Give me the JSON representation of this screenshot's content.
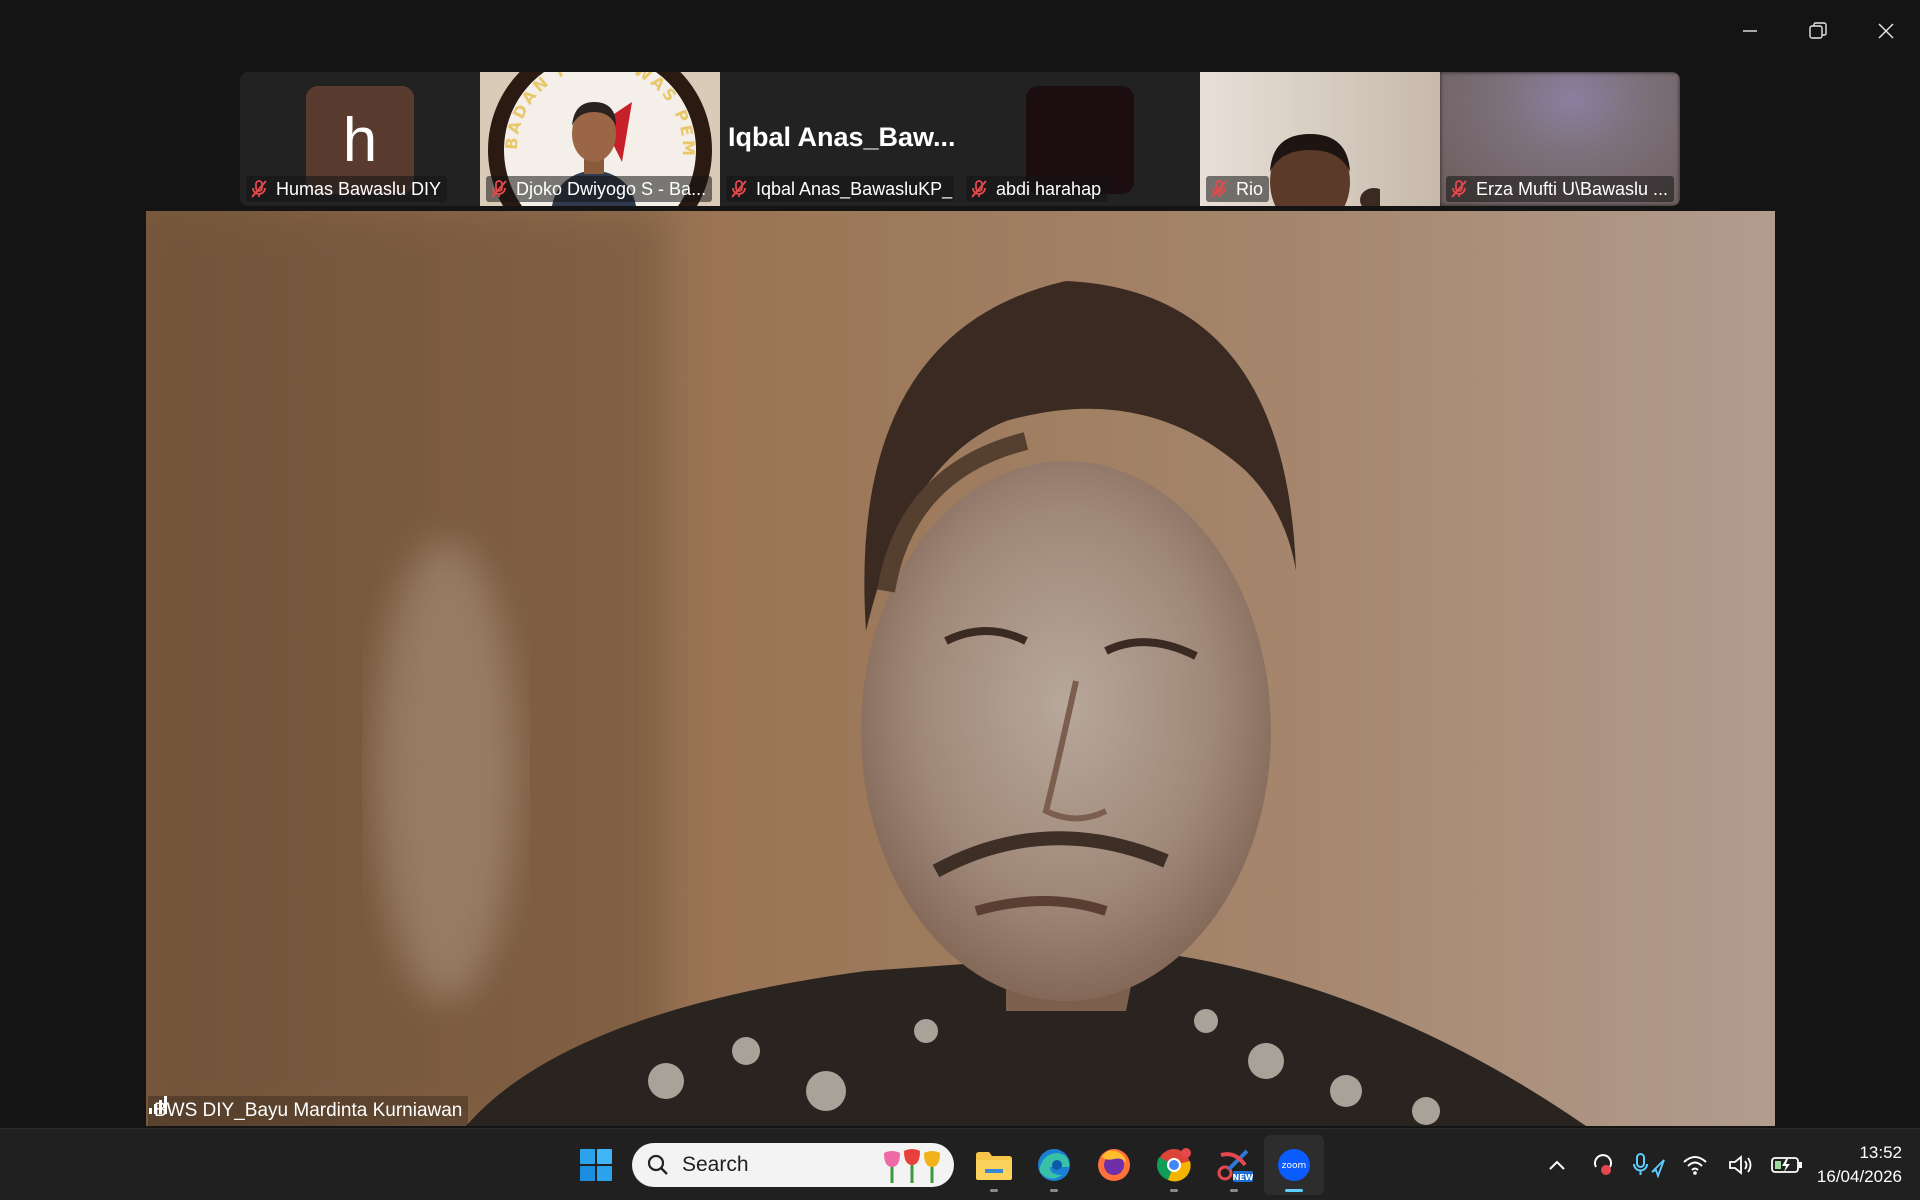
{
  "participants": [
    {
      "name": "Humas Bawaslu DIY",
      "avatar_letter": "h"
    },
    {
      "name": "Djoko Dwiyogo S - Ba..."
    },
    {
      "name": "Iqbal Anas_BawasluKP_",
      "display_title": "Iqbal  Anas_Baw..."
    },
    {
      "name": "abdi harahap"
    },
    {
      "name": "Rio"
    },
    {
      "name": "Erza Mufti U\\Bawaslu ..."
    }
  ],
  "seal_text": "BADAN PENGAWAS PEMILIHAN UMUM",
  "active_speaker": {
    "name": "BWS DIY_Bayu Mardinta Kurniawan"
  },
  "taskbar": {
    "search_placeholder": "Search",
    "apps": [
      "windows-start",
      "file-explorer",
      "edge",
      "firefox",
      "chrome",
      "snipping-tool",
      "zoom"
    ],
    "zoom_label": "zoom",
    "new_badge": "NEW"
  },
  "clock": {
    "time": "13:52",
    "date": "16/04/2026"
  },
  "colors": {
    "taskbar": "#202020",
    "accent": "#60cdff",
    "zoom_blue": "#0b5cff",
    "mute_red": "#e5484d"
  }
}
